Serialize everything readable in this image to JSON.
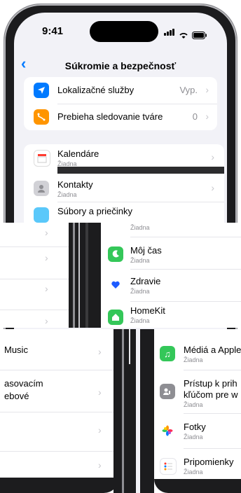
{
  "status": {
    "time": "9:41"
  },
  "nav": {
    "back_glyph": "‹",
    "title": "Súkromie a bezpečnosť"
  },
  "group1": [
    {
      "label": "Lokalizačné služby",
      "value": "Vyp.",
      "icon": "location-arrow-icon",
      "color": "#007aff"
    },
    {
      "label": "Prebieha sledovanie tváre",
      "value": "0",
      "icon": "face-tracking-icon",
      "color": "#ff9500"
    }
  ],
  "group2": [
    {
      "label": "Kalendáre",
      "sub": "Žiadna",
      "icon": "calendar-icon"
    },
    {
      "label": "Kontakty",
      "sub": "Žiadna",
      "icon": "contacts-icon"
    },
    {
      "label": "Súbory a priečinky",
      "icon": "files-icon"
    }
  ],
  "mid": [
    {
      "label": "Žiadna"
    },
    {
      "label": "Môj čas",
      "sub": "Žiadna",
      "icon": "screen-time-icon",
      "color": "#34c759"
    },
    {
      "label": "Zdravie",
      "sub": "Žiadna",
      "icon": "health-icon"
    },
    {
      "label": "HomeKit",
      "sub": "Žiadna",
      "icon": "homekit-icon",
      "color": "#34c759"
    }
  ],
  "left": [
    {
      "label": "Music"
    },
    {
      "label": "asovacím"
    },
    {
      "label": "ebové"
    }
  ],
  "right": [
    {
      "label": "Médiá a Apple",
      "sub": "Žiadna",
      "icon": "media-icon",
      "color": "#34c759"
    },
    {
      "label": "Prístup k prih",
      "label2": "kľúčom pre w",
      "sub": "Žiadna",
      "icon": "passkey-icon",
      "color": "#8e8e93"
    },
    {
      "label": "Fotky",
      "sub": "Žiadna",
      "icon": "photos-icon"
    },
    {
      "label": "Pripomienky",
      "sub": "Žiadna",
      "icon": "reminders-icon"
    }
  ]
}
